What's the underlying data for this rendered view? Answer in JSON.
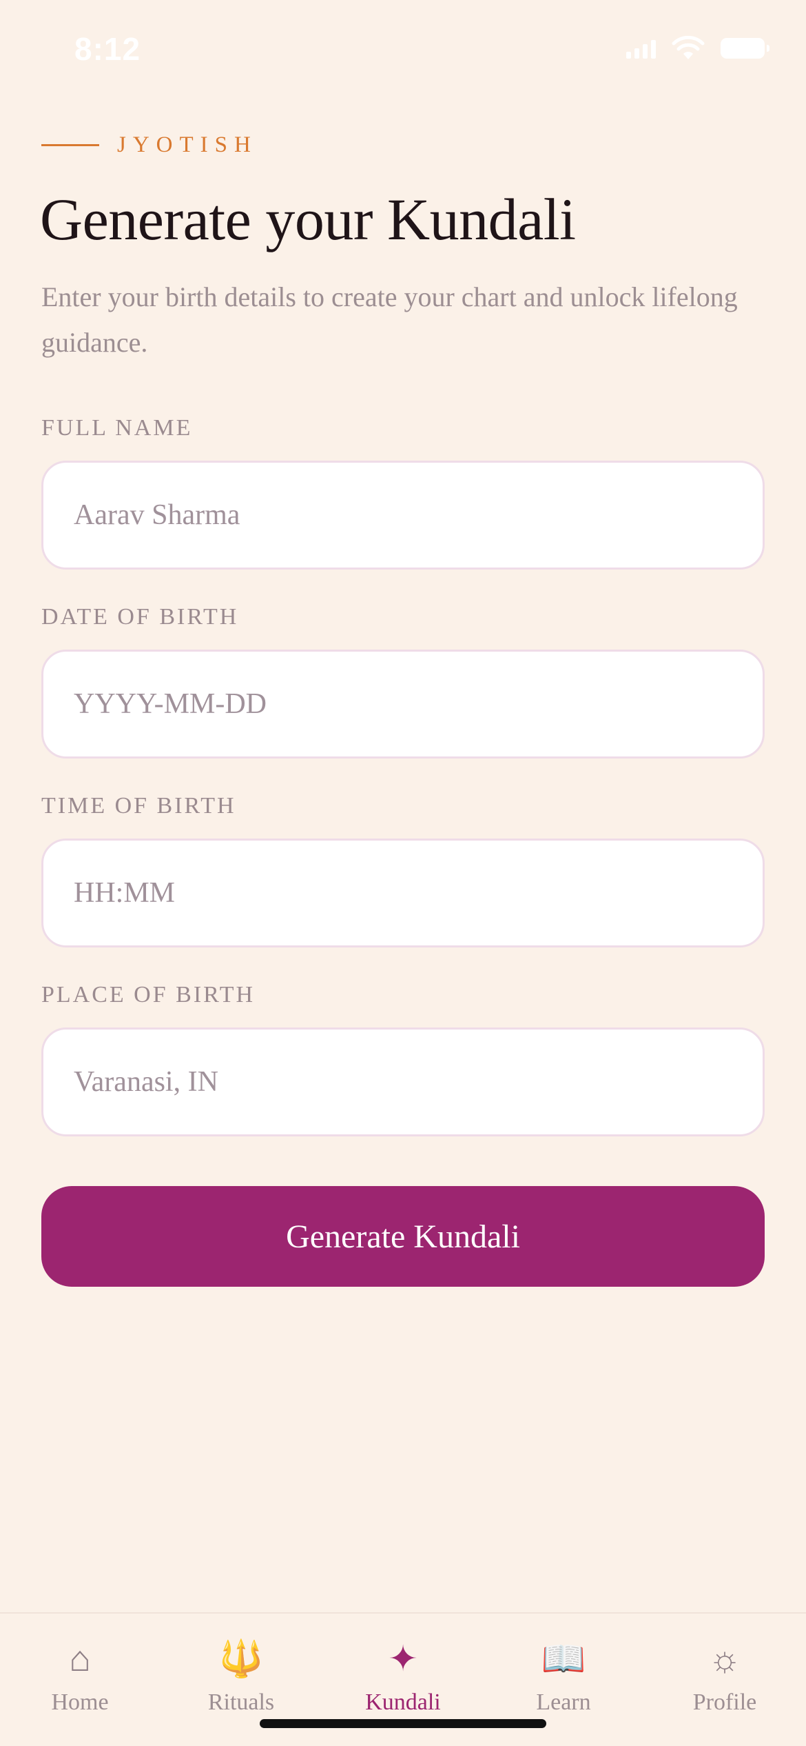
{
  "status_bar": {
    "time": "8:12",
    "icons": [
      "signal-icon",
      "wifi-icon",
      "battery-icon"
    ]
  },
  "header": {
    "eyebrow": "JYOTISH",
    "title": "Generate your Kundali",
    "subtitle": "Enter your birth details to create your chart and unlock lifelong guidance."
  },
  "form": {
    "full_name": {
      "label": "FULL NAME",
      "placeholder": "Aarav Sharma",
      "value": ""
    },
    "date_of_birth": {
      "label": "DATE OF BIRTH",
      "placeholder": "YYYY-MM-DD",
      "value": ""
    },
    "time_of_birth": {
      "label": "TIME OF BIRTH",
      "placeholder": "HH:MM",
      "value": ""
    },
    "place_of_birth": {
      "label": "PLACE OF BIRTH",
      "placeholder": "Varanasi, IN",
      "value": ""
    },
    "submit_label": "Generate Kundali"
  },
  "tab_bar": {
    "items": [
      {
        "label": "Home",
        "icon": "⌂",
        "icon_name": "home-icon",
        "active": false
      },
      {
        "label": "Rituals",
        "icon": "🔱",
        "icon_name": "trident-icon",
        "active": false
      },
      {
        "label": "Kundali",
        "icon": "✦",
        "icon_name": "star-icon",
        "active": true
      },
      {
        "label": "Learn",
        "icon": "📖",
        "icon_name": "book-icon",
        "active": false
      },
      {
        "label": "Profile",
        "icon": "☼",
        "icon_name": "sun-icon",
        "active": false
      }
    ]
  },
  "colors": {
    "background": "#FBF1E8",
    "accent": "#9C2570",
    "eyebrow": "#D9792F",
    "title": "#1F1418",
    "muted": "#9C8E92",
    "input_border": "#EFDCE8"
  }
}
